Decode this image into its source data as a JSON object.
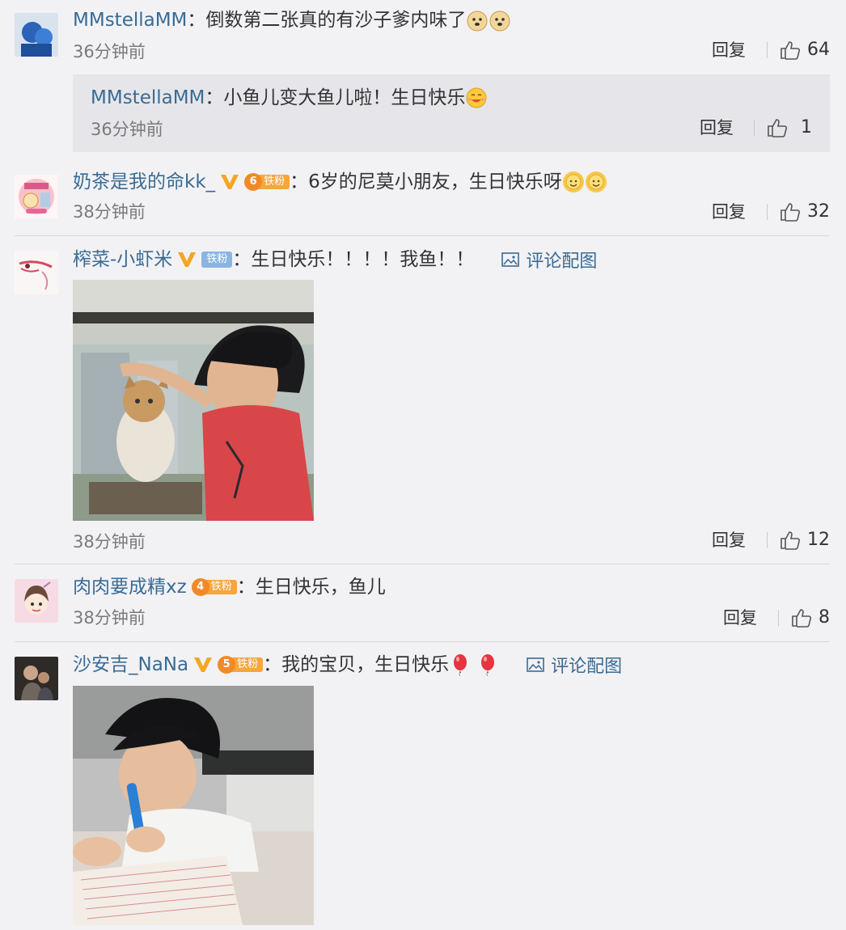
{
  "comments": [
    {
      "user": "MMstellaMM",
      "text": "倒数第二张真的有沙子爹内味了",
      "time": "36分钟前",
      "reply_label": "回复",
      "likes": "64",
      "avatar_icon": "blue-figure-avatar",
      "emoji_icon": "doge-face-emoji",
      "replies": [
        {
          "user": "MMstellaMM",
          "text": "小鱼儿变大鱼儿啦！生日快乐",
          "time": "36分钟前",
          "reply_label": "回复",
          "likes": "1",
          "emoji_icon": "happy-face-emoji"
        }
      ]
    },
    {
      "user": "奶茶是我的命kk_",
      "fan_level": "6",
      "fan_label": "铁粉",
      "text": "6岁的尼莫小朋友，生日快乐呀",
      "time": "38分钟前",
      "reply_label": "回复",
      "likes": "32",
      "emoji_icon": "sun-face-emoji"
    },
    {
      "user": "榨菜-小虾米",
      "fan_label": "铁粉",
      "text": "生日快乐！！！！我鱼！！",
      "pic_label": "评论配图",
      "time": "38分钟前",
      "reply_label": "回复",
      "likes": "12",
      "photo_desc": "boy-petting-cat-photo"
    },
    {
      "user": "肉肉要成精xz",
      "fan_level": "4",
      "fan_label": "铁粉",
      "text": "生日快乐，鱼儿",
      "time": "38分钟前",
      "reply_label": "回复",
      "likes": "8"
    },
    {
      "user": "沙安吉_NaNa",
      "fan_level": "5",
      "fan_label": "铁粉",
      "text": "我的宝贝，生日快乐",
      "pic_label": "评论配图",
      "photo_desc": "boy-writing-photo",
      "emoji_icon": "balloon-emoji"
    }
  ],
  "colors": {
    "background": "#f2f2f5",
    "username": "#3a6b93",
    "vip_v": "#f5a623",
    "fan_badge": "#f6a63d",
    "blue_fan_badge": "#8ab5e3"
  }
}
